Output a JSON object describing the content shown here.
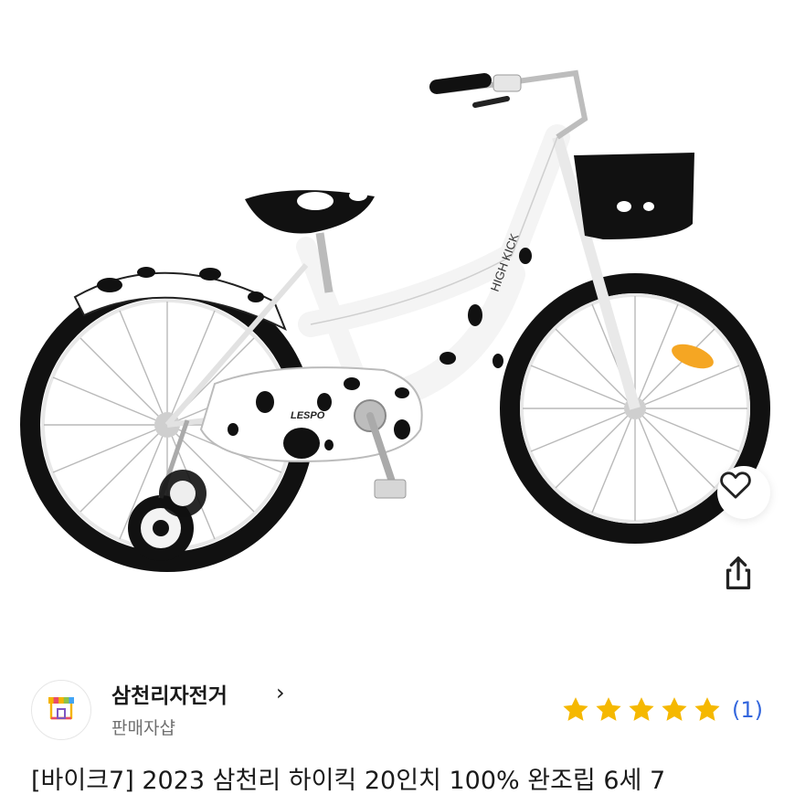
{
  "seller": {
    "name": "삼천리자전거",
    "chevron": "›",
    "type": "판매자샵",
    "logo_icon": "storefront-icon"
  },
  "rating": {
    "stars": 5,
    "max_stars": 5,
    "count_label": "(1)",
    "star_color": "#f5b800"
  },
  "product": {
    "title": "[바이크7] 2023 삼천리 하이킥 20인치 100% 완조립 6세 7",
    "image_brand_text": "LESPO",
    "image_model_text": "HIGH KICK"
  },
  "actions": {
    "like_icon": "heart-icon",
    "share_icon": "share-icon"
  },
  "colors": {
    "accent_blue": "#3366dd",
    "text_secondary": "#6f6f6f"
  }
}
